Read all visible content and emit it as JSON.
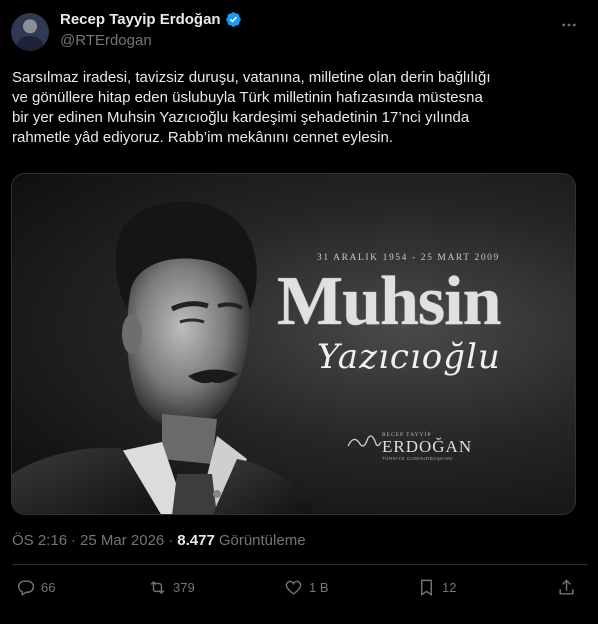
{
  "author": {
    "name": "Recep Tayyip Erdoğan",
    "handle": "@RTErdogan"
  },
  "tweet": {
    "text": "Sarsılmaz iradesi, tavizsiz duruşu, vatanına, milletine olan derin bağlılığı\nve gönüllere hitap eden üslubuyla Türk milletinin hafızasında müstesna\nbir yer edinen Muhsin Yazıcıoğlu kardeşimi şehadetinin 17’nci yılında\nrahmetle yâd ediyoruz. Rabb’im mekânını cennet eylesin."
  },
  "media": {
    "dates": "31 ARALIK 1954 - 25 MART 2009",
    "title": "Muhsin",
    "subtitle": "Yazıcıoğlu",
    "brand_top": "RECEP TAYYİP",
    "brand_main": "ERDOĞAN",
    "brand_sub": "TÜRKİYE CUMHURBAŞKANI"
  },
  "meta": {
    "time": "ÖS 2:16",
    "separator": "·",
    "date": "25 Mar 2026",
    "views_count": "8.477",
    "views_label": "Görüntüleme"
  },
  "actions": {
    "replies": "66",
    "reposts": "379",
    "likes": "1 B",
    "bookmarks": "12"
  },
  "colors": {
    "background": "#000000",
    "text": "#e7e9ea",
    "muted": "#71767b",
    "verified": "#1d9bf0",
    "border": "#2f3336"
  }
}
